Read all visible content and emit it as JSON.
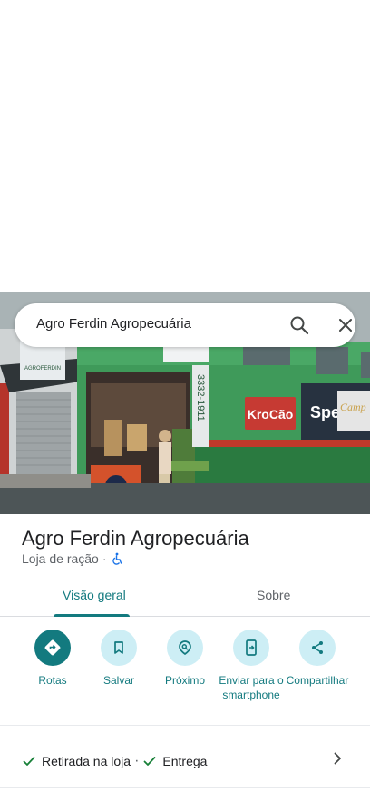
{
  "search": {
    "query": "Agro Ferdin Agropecuária"
  },
  "place": {
    "title": "Agro Ferdin Agropecuária",
    "category": "Loja de ração",
    "separator": "·"
  },
  "tabs": [
    {
      "label": "Visão geral",
      "selected": true
    },
    {
      "label": "Sobre",
      "selected": false
    }
  ],
  "actions": [
    {
      "label": "Rotas",
      "icon": "directions-icon"
    },
    {
      "label": "Salvar",
      "icon": "bookmark-icon"
    },
    {
      "label": "Próximo",
      "icon": "nearby-icon"
    },
    {
      "label": "Enviar para o smartphone",
      "icon": "send-to-phone-icon"
    },
    {
      "label": "Compartilhar",
      "icon": "share-icon"
    }
  ],
  "services": {
    "pickup": "Retirada na loja",
    "delivery": "Entrega",
    "separator": "·"
  },
  "photo_signs": {
    "store_sign": "AGROFERDIN",
    "phone": "3332-1911",
    "brand_1": "KroCão",
    "brand_2": "Spert",
    "brand_3": "Camp"
  },
  "colors": {
    "accent": "#137a7f",
    "action_bg": "#cdeef5",
    "check": "#188038",
    "wheelchair": "#1a73e8"
  }
}
